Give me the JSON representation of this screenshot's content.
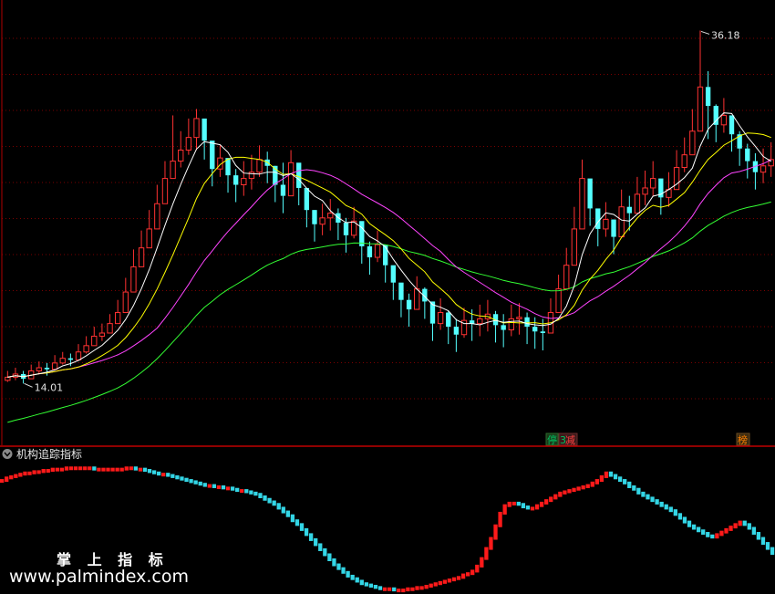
{
  "indicator_panel": {
    "title": "机构追踪指标"
  },
  "watermark": {
    "chinese": "掌 上 指 标",
    "url": "www.palmindex.com"
  },
  "badges": [
    {
      "text": "停",
      "color": "#00c060",
      "bg": "#1a3a1a"
    },
    {
      "text": "减",
      "color": "#ff4040",
      "bg": "#3a1a1a"
    },
    {
      "text": "榜",
      "color": "#ff8000",
      "bg": "#3a2a10"
    }
  ],
  "chart_data": [
    {
      "type": "candlestick",
      "annotations": [
        {
          "text": "36.18",
          "kind": "high"
        },
        {
          "text": "14.01",
          "kind": "low"
        }
      ],
      "ylim": [
        10,
        38
      ],
      "candle_count": 98,
      "colors": {
        "up": "#ff3232",
        "down": "#54ffff",
        "ma5": "#ffffff",
        "ma10": "#ffff00",
        "ma20": "#ff44ff",
        "ma60": "#33ff33"
      },
      "close": [
        14.2,
        14.4,
        14.1,
        14.6,
        14.8,
        14.7,
        15.1,
        15.4,
        15.3,
        15.8,
        16.2,
        16.8,
        17.0,
        17.6,
        18.3,
        19.6,
        21.2,
        22.4,
        23.6,
        25.2,
        26.8,
        27.9,
        28.6,
        29.4,
        30.6,
        29.2,
        27.4,
        28.1,
        27.0,
        26.4,
        26.8,
        27.2,
        28.0,
        27.6,
        26.4,
        25.7,
        27.8,
        26.2,
        24.8,
        23.9,
        24.3,
        24.6,
        24.0,
        23.2,
        24.1,
        22.5,
        21.8,
        22.6,
        21.3,
        20.2,
        19.1,
        18.5,
        19.8,
        19.0,
        17.6,
        18.3,
        17.4,
        16.9,
        17.8,
        17.6,
        17.9,
        18.2,
        17.5,
        17.2,
        17.9,
        18.0,
        17.4,
        17.1,
        17.0,
        18.3,
        19.8,
        21.3,
        23.6,
        26.8,
        24.9,
        23.6,
        24.2,
        23.1,
        25.0,
        24.6,
        25.8,
        26.2,
        26.8,
        25.6,
        26.1,
        27.5,
        28.3,
        29.8,
        32.6,
        31.4,
        30.2,
        30.8,
        29.6,
        28.7,
        27.9,
        27.2,
        27.6,
        28.0
      ],
      "high": [
        14.6,
        14.8,
        14.6,
        15.0,
        15.2,
        15.1,
        15.6,
        15.8,
        15.7,
        16.3,
        16.8,
        17.4,
        17.6,
        18.2,
        19.1,
        20.5,
        22.3,
        23.5,
        24.8,
        26.4,
        27.9,
        30.8,
        29.8,
        30.6,
        31.2,
        30.4,
        28.6,
        28.9,
        28.0,
        27.4,
        27.9,
        28.3,
        28.9,
        28.5,
        27.6,
        27.8,
        28.6,
        27.2,
        25.9,
        24.8,
        25.2,
        25.5,
        24.9,
        24.3,
        25.0,
        23.6,
        22.8,
        23.5,
        22.3,
        21.2,
        20.1,
        19.5,
        20.6,
        19.9,
        18.6,
        19.2,
        18.4,
        17.9,
        18.6,
        18.5,
        18.8,
        19.1,
        18.4,
        18.2,
        18.8,
        18.9,
        18.3,
        18.0,
        17.9,
        19.2,
        20.7,
        22.4,
        25.0,
        28.0,
        26.2,
        24.8,
        25.3,
        24.2,
        26.1,
        25.7,
        26.9,
        27.3,
        27.9,
        26.7,
        27.2,
        28.6,
        29.4,
        31.2,
        36.18,
        33.6,
        31.5,
        31.9,
        30.8,
        29.8,
        29.0,
        28.4,
        28.7,
        29.1
      ],
      "low": [
        13.9,
        14.01,
        13.8,
        14.2,
        14.4,
        14.3,
        14.7,
        15.0,
        14.9,
        15.3,
        15.7,
        16.2,
        16.5,
        17.0,
        17.6,
        18.8,
        20.3,
        21.5,
        22.6,
        24.2,
        25.8,
        26.8,
        27.5,
        28.3,
        28.6,
        28.0,
        26.3,
        26.9,
        25.9,
        25.3,
        25.7,
        26.1,
        26.9,
        26.5,
        25.3,
        24.6,
        26.7,
        25.1,
        23.7,
        22.8,
        23.2,
        23.5,
        22.9,
        22.1,
        23.0,
        21.4,
        20.7,
        21.5,
        20.2,
        19.1,
        18.0,
        17.4,
        18.7,
        17.9,
        16.5,
        17.2,
        16.3,
        15.8,
        16.7,
        16.5,
        16.8,
        17.1,
        16.4,
        16.1,
        16.8,
        16.9,
        16.3,
        16.0,
        15.9,
        17.2,
        18.7,
        20.2,
        22.5,
        24.8,
        23.8,
        22.5,
        23.1,
        22.0,
        23.9,
        23.5,
        24.7,
        25.1,
        25.7,
        24.5,
        25.0,
        26.4,
        27.2,
        28.7,
        30.6,
        29.3,
        29.1,
        29.7,
        28.5,
        27.6,
        26.8,
        26.1,
        26.5,
        26.9
      ],
      "open": [
        14.0,
        14.2,
        14.4,
        14.1,
        14.6,
        14.8,
        14.7,
        15.1,
        15.4,
        15.3,
        15.8,
        16.2,
        16.8,
        17.0,
        17.6,
        18.3,
        19.6,
        21.2,
        22.4,
        23.6,
        25.2,
        26.8,
        27.9,
        28.6,
        29.4,
        30.6,
        29.2,
        27.4,
        28.1,
        27.0,
        26.4,
        26.8,
        27.2,
        28.0,
        27.6,
        26.4,
        25.7,
        27.8,
        26.2,
        24.8,
        23.9,
        24.3,
        24.6,
        24.0,
        23.2,
        24.1,
        22.5,
        21.8,
        22.6,
        21.3,
        20.2,
        19.1,
        18.5,
        19.8,
        19.0,
        17.6,
        18.3,
        17.4,
        16.9,
        17.8,
        17.6,
        17.9,
        18.2,
        17.5,
        17.2,
        17.9,
        18.0,
        17.4,
        17.1,
        17.0,
        18.3,
        19.8,
        21.3,
        23.6,
        26.8,
        24.9,
        23.6,
        24.2,
        23.1,
        25.0,
        24.6,
        25.8,
        26.2,
        26.8,
        25.6,
        26.1,
        27.5,
        28.3,
        29.8,
        32.6,
        31.4,
        30.2,
        30.8,
        29.6,
        28.7,
        27.9,
        27.2,
        27.6
      ]
    },
    {
      "type": "bar",
      "name": "机构追踪指标",
      "bar_count": 168,
      "ylim": [
        0,
        100
      ],
      "colors": {
        "up": "#ff1a1a",
        "down": "#33d6e6"
      },
      "values": [
        88,
        90,
        91,
        92,
        93,
        94,
        94,
        95,
        95,
        96,
        96,
        97,
        97,
        97,
        98,
        98,
        98,
        98,
        98,
        98,
        97,
        97,
        97,
        97,
        97,
        97,
        97,
        98,
        98,
        97,
        97,
        96,
        95,
        94,
        93,
        93,
        92,
        91,
        90,
        89,
        88,
        87,
        86,
        85,
        84,
        84,
        83,
        83,
        82,
        82,
        81,
        80,
        80,
        79,
        78,
        77,
        75,
        73,
        71,
        69,
        66,
        63,
        60,
        56,
        53,
        49,
        45,
        41,
        37,
        33,
        29,
        25,
        21,
        18,
        15,
        12,
        10,
        8,
        6,
        5,
        4,
        3,
        2,
        2,
        2,
        1,
        1,
        1,
        2,
        2,
        3,
        3,
        4,
        5,
        6,
        7,
        8,
        9,
        10,
        11,
        13,
        14,
        16,
        20,
        26,
        34,
        42,
        52,
        62,
        68,
        70,
        70,
        69,
        67,
        66,
        66,
        68,
        70,
        72,
        74,
        76,
        78,
        79,
        80,
        81,
        82,
        83,
        84,
        86,
        88,
        91,
        94,
        92,
        90,
        88,
        86,
        83,
        81,
        78,
        76,
        74,
        72,
        70,
        68,
        66,
        64,
        61,
        58,
        55,
        52,
        50,
        48,
        46,
        44,
        43,
        45,
        47,
        49,
        51,
        53,
        55,
        53,
        50,
        46,
        42,
        38,
        34,
        30
      ]
    }
  ]
}
